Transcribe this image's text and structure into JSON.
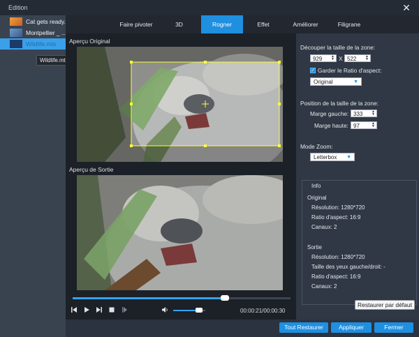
{
  "window": {
    "title": "Edition"
  },
  "files": [
    {
      "name": "Cat gets ready..."
    },
    {
      "name": "Montpellier _ ..."
    },
    {
      "name": "Wildlife.mts"
    }
  ],
  "tooltip": "Wildlife.mts",
  "tabs": [
    "Faire pivoter",
    "3D",
    "Rogner",
    "Effet",
    "Améliorer",
    "Filigrane"
  ],
  "active_tab": "Rogner",
  "preview": {
    "original_label": "Aperçu Original",
    "output_label": "Aperçu de Sortie",
    "time": "00:00:21/00:00:30",
    "seek_fraction": 0.7,
    "volume_fraction": 0.8
  },
  "crop": {
    "title": "Découper la taille de la zone:",
    "width": "929",
    "x": "X",
    "height": "522",
    "keep_ratio_label": "Garder le Ratio d'aspect:",
    "keep_ratio_checked": true,
    "ratio_value": "Original",
    "position_title": "Position de la taille de la zone:",
    "left_margin_label": "Marge gauche:",
    "left_margin": "333",
    "top_margin_label": "Marge haute:",
    "top_margin": "97",
    "zoom_label": "Mode Zoom:",
    "zoom_value": "Letterbox"
  },
  "info": {
    "title": "Info",
    "original_title": "Original",
    "original_resolution": "Résolution: 1280*720",
    "original_ratio": "Ratio d'aspect: 16:9",
    "original_channels": "Canaux: 2",
    "output_title": "Sortie",
    "output_resolution": "Résolution: 1280*720",
    "output_eyes": "Taille des yeux gauche/droit: -",
    "output_ratio": "Ratio d'aspect: 16:9",
    "output_channels": "Canaux: 2"
  },
  "buttons": {
    "reset": "Restaurer par défaut",
    "reset_all": "Tout Restaurer",
    "apply": "Appliquer",
    "close": "Fermer"
  },
  "colors": {
    "accent": "#1f8fe0",
    "crop_box": "#ffff3a"
  }
}
